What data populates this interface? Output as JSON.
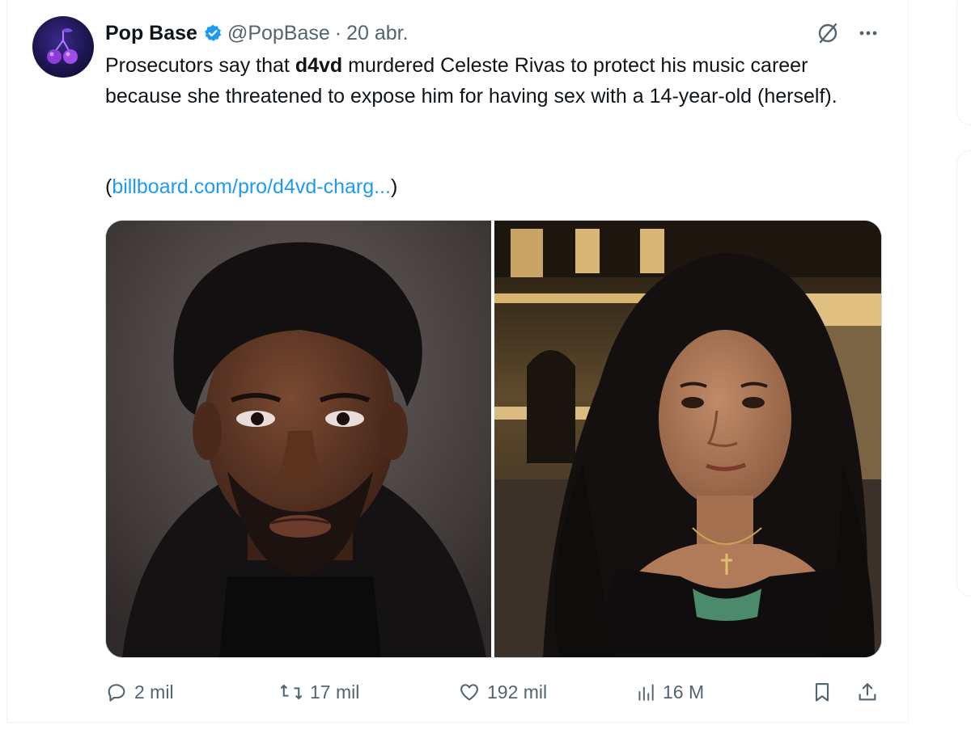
{
  "tweet": {
    "author_name": "Pop Base",
    "handle": "@PopBase",
    "separator": "·",
    "date": "20 abr.",
    "text_parts": {
      "before": "Prosecutors say that ",
      "bold": "d4vd",
      "after": " murdered Celeste Rivas to protect his music career because she threatened to expose him for having sex with a 14-year-old (herself)."
    },
    "link_open": "(",
    "link_text": "billboard.com/pro/d4vd-charg...",
    "link_close": ")",
    "media": [
      {
        "icon": "photo-man-mugshot"
      },
      {
        "icon": "photo-young-woman"
      }
    ],
    "actions": {
      "replies": "2 mil",
      "reposts": "17 mil",
      "likes": "192 mil",
      "views": "16 M"
    }
  },
  "icons": {
    "verified": "verified-badge-icon",
    "grok": "grok-icon",
    "more": "more-icon",
    "reply": "reply-icon",
    "repost": "repost-icon",
    "like": "like-icon",
    "views": "views-icon",
    "bookmark": "bookmark-icon",
    "share": "share-icon"
  },
  "colors": {
    "accent": "#1d9bf0",
    "secondary_text": "#536471",
    "primary_text": "#0f1419",
    "border": "#eff3f4"
  }
}
